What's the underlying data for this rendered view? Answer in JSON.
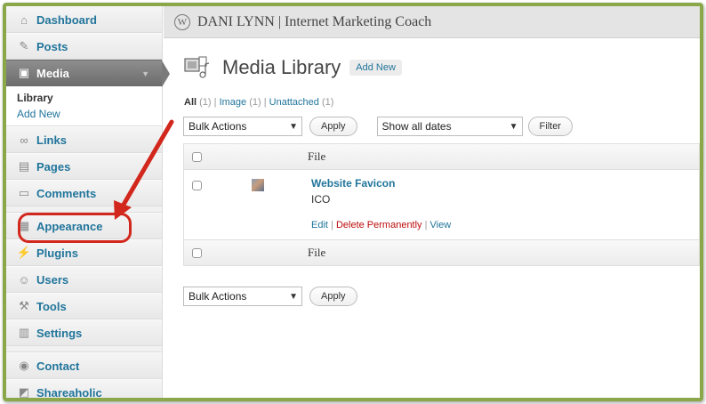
{
  "sidebar": {
    "items": [
      {
        "label": "Dashboard",
        "icon": "house-icon"
      },
      {
        "label": "Posts",
        "icon": "pin-icon"
      },
      {
        "label": "Media",
        "icon": "media-icon"
      },
      {
        "label": "Links",
        "icon": "link-icon"
      },
      {
        "label": "Pages",
        "icon": "page-icon"
      },
      {
        "label": "Comments",
        "icon": "comment-icon"
      },
      {
        "label": "Appearance",
        "icon": "appearance-icon"
      },
      {
        "label": "Plugins",
        "icon": "plug-icon"
      },
      {
        "label": "Users",
        "icon": "users-icon"
      },
      {
        "label": "Tools",
        "icon": "tools-icon"
      },
      {
        "label": "Settings",
        "icon": "settings-icon"
      },
      {
        "label": "Contact",
        "icon": "contact-icon"
      },
      {
        "label": "Shareaholic",
        "icon": "shareaholic-icon"
      }
    ],
    "media_submenu": [
      "Library",
      "Add New"
    ]
  },
  "header": {
    "site_title": "DANI LYNN | Internet Marketing Coach"
  },
  "page": {
    "title": "Media Library",
    "add_new": "Add New"
  },
  "filters": {
    "all": "All",
    "all_count": "(1)",
    "image": "Image",
    "image_count": "(1)",
    "unattached": "Unattached",
    "unattached_count": "(1)",
    "sep": "|"
  },
  "actions": {
    "bulk_actions": "Bulk Actions",
    "apply": "Apply",
    "show_all_dates": "Show all dates",
    "filter": "Filter"
  },
  "table": {
    "header_file": "File",
    "footer_file": "File",
    "rows": [
      {
        "title": "Website Favicon",
        "type": "ICO",
        "edit": "Edit",
        "delete": "Delete Permanently",
        "view": "View"
      }
    ]
  },
  "colors": {
    "link": "#21759b",
    "highlight": "#d2271c",
    "frame": "#8aa84a"
  }
}
